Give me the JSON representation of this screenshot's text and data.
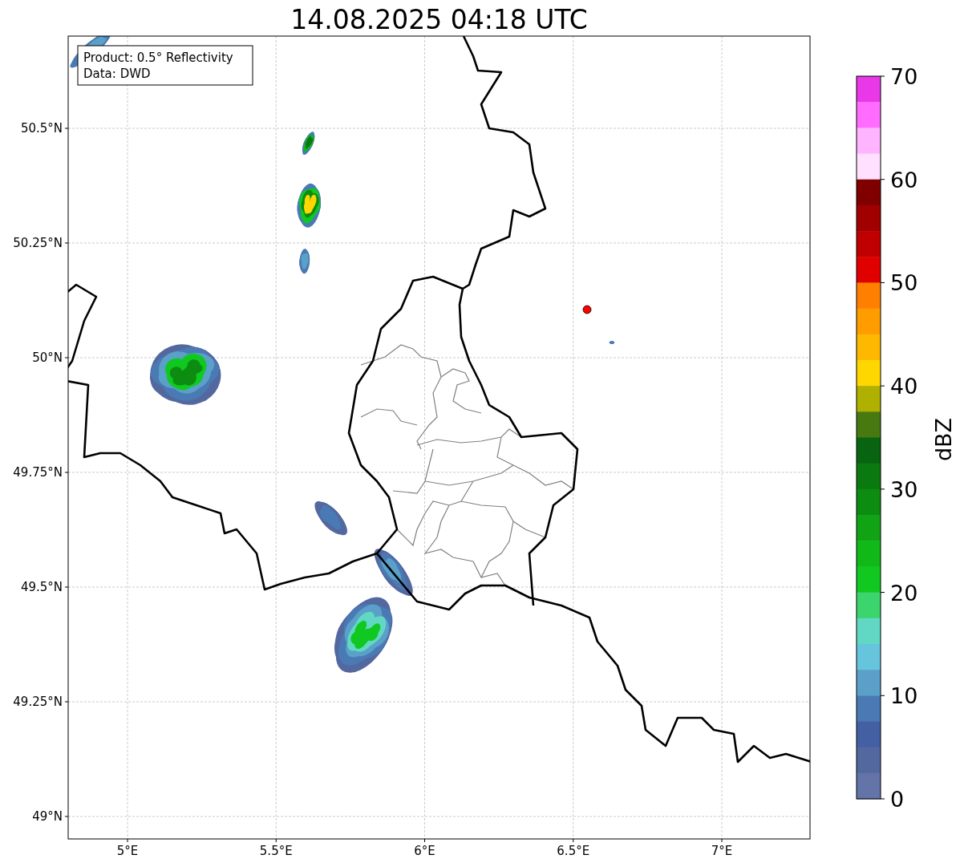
{
  "title": "14.08.2025 04:18 UTC",
  "legend": [
    "Product: 0.5° Reflectivity",
    "Data: DWD"
  ],
  "map": {
    "xticks": [
      "5°E",
      "5.5°E",
      "6°E",
      "6.5°E",
      "7°E"
    ],
    "yticks": [
      "50.5°N",
      "50.25°N",
      "50°N",
      "49.75°N",
      "49.5°N",
      "49.25°N",
      "49°N"
    ]
  },
  "colorbar": {
    "label": "dBZ",
    "ticks": [
      "70",
      "60",
      "50",
      "40",
      "30",
      "20",
      "10",
      "0"
    ],
    "bands": [
      {
        "color": "#e838e8"
      },
      {
        "color": "#ff6cff"
      },
      {
        "color": "#ffb4ff"
      },
      {
        "color": "#ffe0ff"
      },
      {
        "color": "#800000"
      },
      {
        "color": "#a00000"
      },
      {
        "color": "#c00000"
      },
      {
        "color": "#e00000"
      },
      {
        "color": "#ff8000"
      },
      {
        "color": "#ff9c00"
      },
      {
        "color": "#ffb800"
      },
      {
        "color": "#ffd700"
      },
      {
        "color": "#b0b000"
      },
      {
        "color": "#487810"
      },
      {
        "color": "#086410"
      },
      {
        "color": "#0a7a10"
      },
      {
        "color": "#0c8c10"
      },
      {
        "color": "#10a414"
      },
      {
        "color": "#10b818"
      },
      {
        "color": "#10c820"
      },
      {
        "color": "#3cd46c"
      },
      {
        "color": "#62d8c4"
      },
      {
        "color": "#66c4dc"
      },
      {
        "color": "#5aa0c8"
      },
      {
        "color": "#4a7ab4"
      },
      {
        "color": "#4460a4"
      },
      {
        "color": "#5468a0"
      },
      {
        "color": "#6474a8"
      }
    ]
  }
}
